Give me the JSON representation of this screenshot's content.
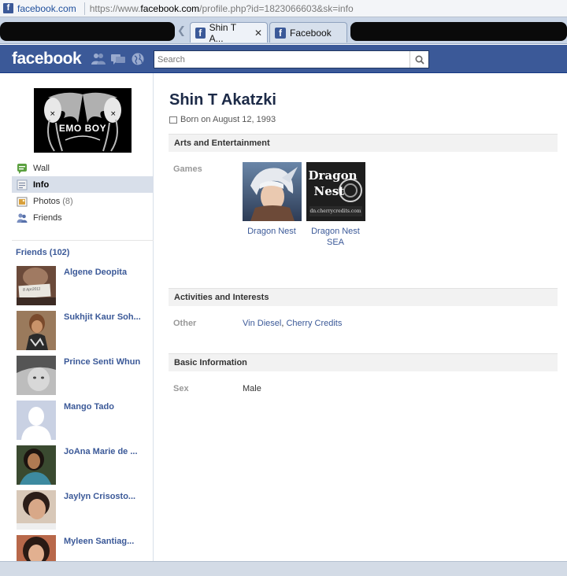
{
  "browser": {
    "address_domain": "facebook.com",
    "address_url_prefix": "https://www.",
    "address_url_host": "facebook.com",
    "address_url_path": "/profile.php?id=1823066603&sk=info",
    "tabs": [
      {
        "label": "Shin T A...",
        "active": true
      },
      {
        "label": "Facebook",
        "active": false
      }
    ]
  },
  "header": {
    "logo": "facebook",
    "search_placeholder": "Search"
  },
  "profile_picture": {
    "caption": "EMO BOY"
  },
  "nav": {
    "items": [
      {
        "label": "Wall",
        "count": "",
        "icon": "wall-icon"
      },
      {
        "label": "Info",
        "count": "",
        "icon": "info-icon",
        "selected": true
      },
      {
        "label": "Photos",
        "count": "(8)",
        "icon": "photos-icon"
      },
      {
        "label": "Friends",
        "count": "",
        "icon": "friends-icon"
      }
    ]
  },
  "friends": {
    "title": "Friends (102)",
    "list": [
      {
        "name": "Algene Deopita",
        "thumb_note": "8 Apr2011"
      },
      {
        "name": "Sukhjit Kaur Soh..."
      },
      {
        "name": "Prince Senti Whun"
      },
      {
        "name": "Mango Tado"
      },
      {
        "name": "JoAna Marie de ..."
      },
      {
        "name": "Jaylyn Crisosto..."
      },
      {
        "name": "Myleen Santiag..."
      }
    ]
  },
  "profile": {
    "name": "Shin T Akatzki",
    "born": "Born on August 12, 1993"
  },
  "sections": {
    "arts": {
      "title": "Arts and Entertainment",
      "games_label": "Games",
      "games": [
        {
          "name": "Dragon Nest"
        },
        {
          "name": "Dragon Nest SEA",
          "logo_line1": "Dragon",
          "logo_line2": "Nest",
          "logo_url": "dn.cherrycredits.com"
        }
      ]
    },
    "activities": {
      "title": "Activities and Interests",
      "other_label": "Other",
      "other_values": [
        "Vin Diesel",
        "Cherry Credits"
      ],
      "separator": ", "
    },
    "basic": {
      "title": "Basic Information",
      "sex_label": "Sex",
      "sex_value": "Male"
    }
  },
  "colors": {
    "fb_blue": "#3b5998",
    "header_border": "#133783",
    "link": "#3b5998",
    "section_bg": "#f2f2f2"
  }
}
